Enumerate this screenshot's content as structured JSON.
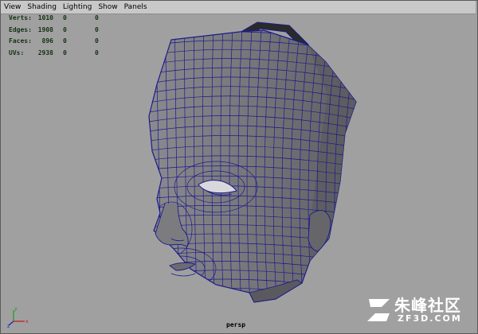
{
  "menu": [
    "View",
    "Shading",
    "Lighting",
    "Show",
    "Panels"
  ],
  "stats": [
    {
      "label": "Verts:",
      "v1": "1010",
      "v2": "0",
      "v3": "0"
    },
    {
      "label": "Edges:",
      "v1": "1908",
      "v2": "0",
      "v3": "0"
    },
    {
      "label": "Faces:",
      "v1": "896",
      "v2": "0",
      "v3": "0"
    },
    {
      "label": "UVs:",
      "v1": "2938",
      "v2": "0",
      "v3": "0"
    }
  ],
  "camera": "persp",
  "watermark": {
    "text": "朱峰社区",
    "sub": "ZF3D.COM"
  },
  "colors": {
    "viewport_bg": "#a0a0a0",
    "mesh_fill": "#7a7a7e",
    "wireframe": "#1a1a8c",
    "hud_text": "#143214"
  }
}
